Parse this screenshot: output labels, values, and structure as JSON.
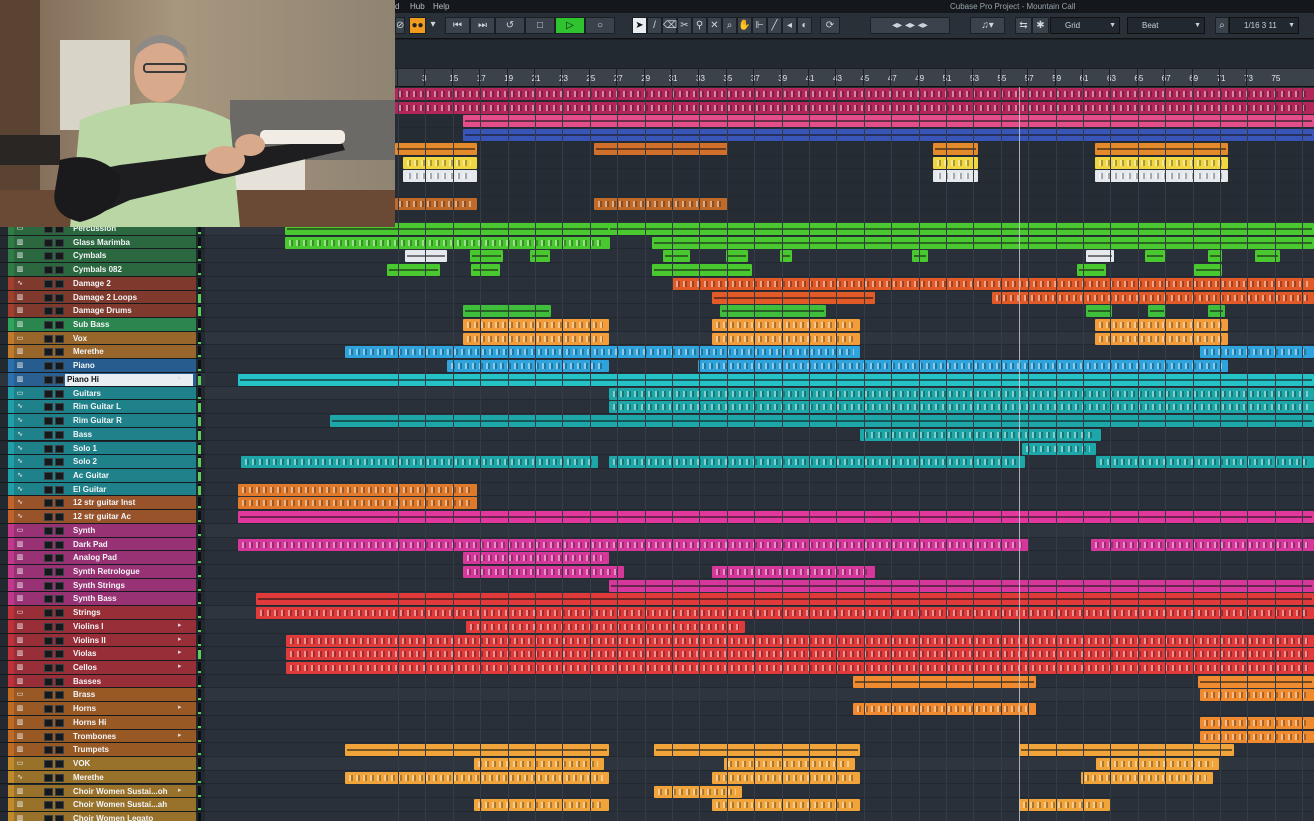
{
  "window": {
    "title": "Cubase Pro Project - Mountain Call"
  },
  "menu": [
    {
      "label": "d"
    },
    {
      "label": "Hub"
    },
    {
      "label": "Help"
    }
  ],
  "toolbar": {
    "grid_type": "Grid",
    "quantize": "Beat",
    "quantize_value": "1/16 3 11"
  },
  "ruler": {
    "bars": [
      "3",
      "15",
      "17",
      "19",
      "21",
      "23",
      "25",
      "27",
      "29",
      "31",
      "33",
      "35",
      "37",
      "39",
      "41",
      "43",
      "45",
      "47",
      "49",
      "51",
      "53",
      "55",
      "57",
      "59",
      "61",
      "63",
      "65",
      "67",
      "69",
      "71",
      "73",
      "75"
    ]
  },
  "colors": {
    "playhead": "#c9ced3",
    "grid_bg": "#2a3039"
  },
  "tracks": [
    {
      "name": "Percussion",
      "color": "#2f7d44",
      "icon": "folder-icon"
    },
    {
      "name": "Glass Marimba",
      "color": "#2f7d44",
      "icon": "instrument-icon"
    },
    {
      "name": "Cymbals",
      "color": "#2f7d44",
      "icon": "instrument-icon"
    },
    {
      "name": "Cymbals 082",
      "color": "#2f7d44",
      "icon": "instrument-icon"
    },
    {
      "name": "Damage 2",
      "color": "#a0402c",
      "icon": "audio-icon"
    },
    {
      "name": "Damage 2 Loops",
      "color": "#a0402c",
      "icon": "instrument-icon"
    },
    {
      "name": "Damage Drums",
      "color": "#a0402c",
      "icon": "instrument-icon"
    },
    {
      "name": "Sub Bass",
      "color": "#2fa45a",
      "icon": "instrument-icon"
    },
    {
      "name": "Vox",
      "color": "#c07a2a",
      "icon": "folder-icon"
    },
    {
      "name": "Merethe",
      "color": "#c07a2a",
      "icon": "instrument-icon"
    },
    {
      "name": "Piano",
      "color": "#2a6fae",
      "icon": "instrument-icon"
    },
    {
      "name": "Piano Hi",
      "color": "#2a6fae",
      "icon": "instrument-icon"
    },
    {
      "name": "Guitars",
      "color": "#1fa0a8",
      "icon": "folder-icon"
    },
    {
      "name": "Rim Guitar L",
      "color": "#1fa0a8",
      "icon": "audio-icon"
    },
    {
      "name": "Rim Guitar R",
      "color": "#1fa0a8",
      "icon": "audio-icon"
    },
    {
      "name": "Bass",
      "color": "#1fa0a8",
      "icon": "audio-icon"
    },
    {
      "name": "Solo 1",
      "color": "#1fa0a8",
      "icon": "audio-icon"
    },
    {
      "name": "Solo 2",
      "color": "#1fa0a8",
      "icon": "audio-icon"
    },
    {
      "name": "Ac Guitar",
      "color": "#1fa0a8",
      "icon": "audio-icon"
    },
    {
      "name": "El Guitar",
      "color": "#1fa0a8",
      "icon": "audio-icon"
    },
    {
      "name": "12 str guitar Inst",
      "color": "#c0622a",
      "icon": "audio-icon"
    },
    {
      "name": "12 str guitar Ac",
      "color": "#c0622a",
      "icon": "audio-icon"
    },
    {
      "name": "Synth",
      "color": "#c2368c",
      "icon": "folder-icon"
    },
    {
      "name": "Dark Pad",
      "color": "#c2368c",
      "icon": "instrument-icon"
    },
    {
      "name": "Analog Pad",
      "color": "#c2368c",
      "icon": "instrument-icon"
    },
    {
      "name": "Synth Retrologue",
      "color": "#c2368c",
      "icon": "instrument-icon"
    },
    {
      "name": "Synth Strings",
      "color": "#c2368c",
      "icon": "instrument-icon"
    },
    {
      "name": "Synth Bass",
      "color": "#c2368c",
      "icon": "instrument-icon"
    },
    {
      "name": "Strings",
      "color": "#c0303a",
      "icon": "folder-icon"
    },
    {
      "name": "Violins I",
      "color": "#c0303a",
      "icon": "instrument-icon"
    },
    {
      "name": "Violins II",
      "color": "#c0303a",
      "icon": "instrument-icon"
    },
    {
      "name": "Violas",
      "color": "#c0303a",
      "icon": "instrument-icon"
    },
    {
      "name": "Cellos",
      "color": "#c0303a",
      "icon": "instrument-icon"
    },
    {
      "name": "Basses",
      "color": "#c0303a",
      "icon": "instrument-icon"
    },
    {
      "name": "Brass",
      "color": "#c06a22",
      "icon": "folder-icon"
    },
    {
      "name": "Horns",
      "color": "#c06a22",
      "icon": "instrument-icon"
    },
    {
      "name": "Horns Hi",
      "color": "#c06a22",
      "icon": "instrument-icon"
    },
    {
      "name": "Trombones",
      "color": "#c06a22",
      "icon": "instrument-icon"
    },
    {
      "name": "Trumpets",
      "color": "#c06a22",
      "icon": "instrument-icon"
    },
    {
      "name": "VOK",
      "color": "#c08a2a",
      "icon": "folder-icon"
    },
    {
      "name": "Merethe",
      "color": "#c08a2a",
      "icon": "audio-icon"
    },
    {
      "name": "Choir Women Sustai...oh",
      "color": "#c08a2a",
      "icon": "instrument-icon"
    },
    {
      "name": "Choir Women Sustai...ah",
      "color": "#c08a2a",
      "icon": "instrument-icon"
    },
    {
      "name": "Choir Women Legato",
      "color": "#c08a2a",
      "icon": "instrument-icon"
    }
  ]
}
